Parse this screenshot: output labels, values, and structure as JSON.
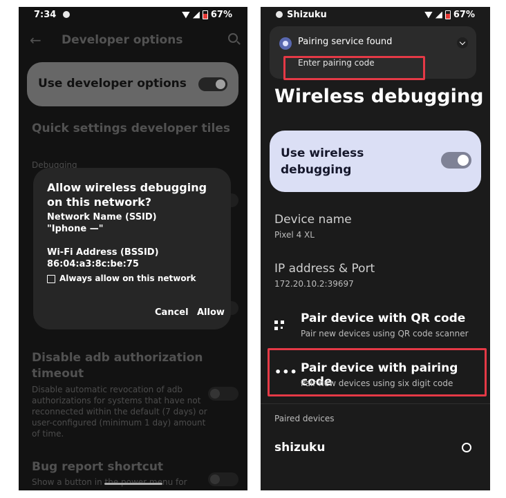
{
  "left_phone": {
    "status": {
      "time": "7:34",
      "battery": "67%"
    },
    "header": {
      "title": "Developer options"
    },
    "use_dev_options": {
      "label": "Use developer options"
    },
    "quick_settings": {
      "title": "Quick settings developer tiles"
    },
    "debugging": {
      "label": "Debugging"
    },
    "dialog": {
      "title": "Allow wireless debugging on this network?",
      "ssid_label": "Network Name (SSID)",
      "ssid_value": "\"Iphone —\"",
      "bssid_label": "Wi-Fi Address (BSSID)",
      "bssid_value": "86:04:a3:8c:be:75",
      "checkbox_label": "Always allow on this network",
      "cancel": "Cancel",
      "allow": "Allow"
    },
    "adb_timeout": {
      "title": "Disable adb authorization timeout",
      "description": "Disable automatic revocation of adb authorizations for systems that have not reconnected within the default (7 days) or user-configured (minimum 1 day) amount of time."
    },
    "bug_report": {
      "title": "Bug report shortcut",
      "description": "Show a button in the power menu for"
    }
  },
  "right_phone": {
    "status": {
      "app": "Shizuku",
      "battery": "67%"
    },
    "notification": {
      "title": "Pairing service found",
      "action": "Enter pairing code"
    },
    "page_title": "Wireless debugging",
    "use_wireless": {
      "label": "Use wireless debugging"
    },
    "device_name": {
      "label": "Device name",
      "value": "Pixel 4 XL"
    },
    "ip_port": {
      "label": "IP address & Port",
      "value": "172.20.10.2:39697"
    },
    "pair_qr": {
      "title": "Pair device with QR code",
      "subtitle": "Pair new devices using QR code scanner"
    },
    "pair_code": {
      "title": "Pair device with pairing code",
      "subtitle": "Pair new devices using six digit code"
    },
    "paired_devices": {
      "label": "Paired devices"
    },
    "paired_item": {
      "name": "shizuku"
    }
  },
  "colors": {
    "highlight": "#e53946",
    "card_light": "#dbdff5",
    "notification_icon": "#5968b0"
  }
}
